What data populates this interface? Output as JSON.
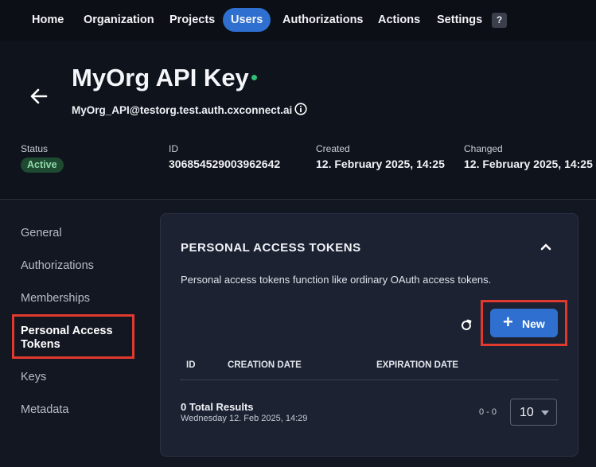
{
  "nav": {
    "items": [
      {
        "label": "Home"
      },
      {
        "label": "Organization"
      },
      {
        "label": "Projects"
      },
      {
        "label": "Users"
      },
      {
        "label": "Authorizations"
      },
      {
        "label": "Actions"
      },
      {
        "label": "Settings"
      }
    ],
    "active_item": "Users",
    "help_label": "?"
  },
  "header": {
    "title": "MyOrg API Key",
    "subtitle": "MyOrg_API@testorg.test.auth.cxconnect.ai",
    "status_dot_color": "#2fbf7a",
    "back_icon": "arrow-left-icon",
    "info_icon": "info-icon"
  },
  "meta": {
    "status": {
      "label": "Status",
      "value": "Active"
    },
    "id": {
      "label": "ID",
      "value": "306854529003962642"
    },
    "created": {
      "label": "Created",
      "value": "12. February 2025, 14:25"
    },
    "changed": {
      "label": "Changed",
      "value": "12. February 2025, 14:25"
    }
  },
  "sidebar": {
    "items": [
      {
        "label": "General"
      },
      {
        "label": "Authorizations"
      },
      {
        "label": "Memberships"
      },
      {
        "label": "Personal Access Tokens"
      },
      {
        "label": "Keys"
      },
      {
        "label": "Metadata"
      }
    ],
    "active_item": "Personal Access Tokens"
  },
  "panel": {
    "title": "PERSONAL ACCESS TOKENS",
    "description": "Personal access tokens function like ordinary OAuth access tokens.",
    "new_button": "New",
    "columns": [
      "ID",
      "CREATION DATE",
      "EXPIRATION DATE"
    ],
    "total_results": "0 Total Results",
    "timestamp": "Wednesday 12. Feb 2025, 14:29",
    "range": "0 - 0",
    "page_size": "10"
  },
  "colors": {
    "accent": "#2e6fd0",
    "highlight": "#e03a2f",
    "status_badge_bg": "#1f4a32",
    "status_badge_text": "#8fd9a8"
  }
}
